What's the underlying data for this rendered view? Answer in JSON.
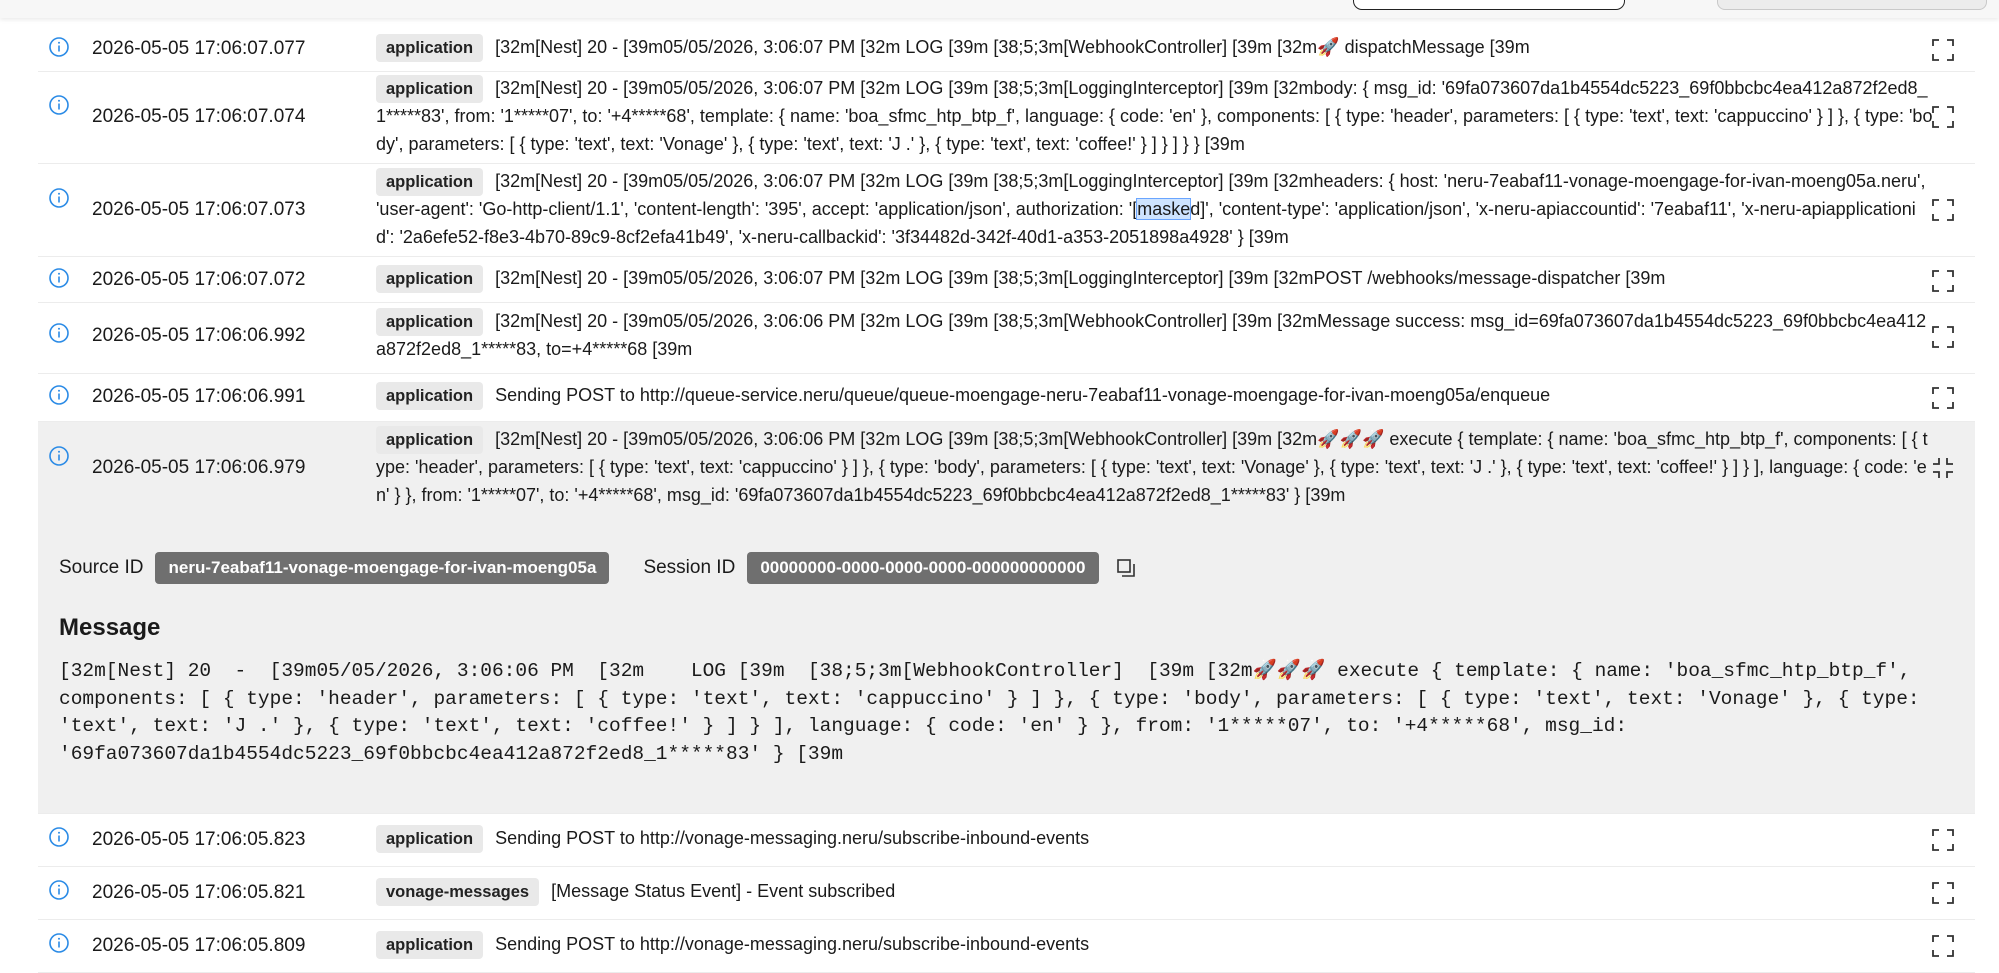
{
  "colors": {
    "accent": "#2b8be6",
    "badge_bg": "#e9e9e9",
    "chip_bg": "#6f6f6f",
    "selected_bg": "#f0f0f0"
  },
  "logs": [
    {
      "timestamp": "2026-05-05 17:06:07.077",
      "badge": "application",
      "text": "[32m[Nest] 20 -  [39m05/05/2026, 3:06:07 PM  [32m LOG [39m  [38;5;3m[WebhookController]  [39m [32m🚀 dispatchMessage [39m"
    },
    {
      "timestamp": "2026-05-05 17:06:07.074",
      "badge": "application",
      "text": "[32m[Nest] 20 -  [39m05/05/2026, 3:06:07 PM  [32m LOG [39m  [38;5;3m[LoggingInterceptor]  [39m [32mbody: { msg_id: '69fa073607da1b4554dc5223_69f0bbcbc4ea412a872f2ed8_1*****83', from: '1*****07', to: '+4*****68', template: { name: 'boa_sfmc_htp_btp_f', language: { code: 'en' }, components: [ { type: 'header', parameters: [ { type: 'text', text: 'cappuccino' } ] }, { type: 'body', parameters: [ { type: 'text', text: 'Vonage' }, { type: 'text', text: 'J .' }, { type: 'text', text: 'coffee!' } ] } ] } } [39m"
    },
    {
      "timestamp": "2026-05-05 17:06:07.073",
      "badge": "application",
      "text_before": "[32m[Nest] 20 -  [39m05/05/2026, 3:06:07 PM  [32m LOG [39m  [38;5;3m[LoggingInterceptor]  [39m [32mheaders: { host: 'neru-7eabaf11-vonage-moengage-for-ivan-moeng05a.neru', 'user-agent': 'Go-http-client/1.1', 'content-length': '395', accept: 'application/json', authorization: '[",
      "text_highlight": "maske",
      "text_after": "d]', 'content-type': 'application/json', 'x-neru-apiaccountid': '7eabaf11', 'x-neru-apiapplicationid': '2a6efe52-f8e3-4b70-89c9-8cf2efa41b49', 'x-neru-callbackid': '3f34482d-342f-40d1-a353-2051898a4928' } [39m"
    },
    {
      "timestamp": "2026-05-05 17:06:07.072",
      "badge": "application",
      "text": "[32m[Nest] 20 -  [39m05/05/2026, 3:06:07 PM  [32m LOG [39m  [38;5;3m[LoggingInterceptor]  [39m [32mPOST /webhooks/message-dispatcher [39m"
    },
    {
      "timestamp": "2026-05-05 17:06:06.992",
      "badge": "application",
      "text": "[32m[Nest] 20 -  [39m05/05/2026, 3:06:06 PM  [32m LOG [39m  [38;5;3m[WebhookController]  [39m [32mMessage success: msg_id=69fa073607da1b4554dc5223_69f0bbcbc4ea412a872f2ed8_1*****83, to=+4*****68 [39m"
    },
    {
      "timestamp": "2026-05-05 17:06:06.991",
      "badge": "application",
      "text": "Sending POST to http://queue-service.neru/queue/queue-moengage-neru-7eabaf11-vonage-moengage-for-ivan-moeng05a/enqueue"
    },
    {
      "timestamp": "2026-05-05 17:06:06.979",
      "badge": "application",
      "text": "[32m[Nest] 20 -  [39m05/05/2026, 3:06:06 PM  [32m LOG [39m  [38;5;3m[WebhookController]  [39m [32m🚀🚀🚀 execute { template: { name: 'boa_sfmc_htp_btp_f', components: [ { type: 'header', parameters: [ { type: 'text', text: 'cappuccino' } ] }, { type: 'body', parameters: [ { type: 'text', text: 'Vonage' }, { type: 'text', text: 'J .' }, { type: 'text', text: 'coffee!' } ] } ], language: { code: 'en' } }, from: '1*****07', to: '+4*****68', msg_id: '69fa073607da1b4554dc5223_69f0bbcbc4ea412a872f2ed8_1*****83' } [39m"
    },
    {
      "timestamp": "2026-05-05 17:06:05.823",
      "badge": "application",
      "text": "Sending POST to http://vonage-messaging.neru/subscribe-inbound-events"
    },
    {
      "timestamp": "2026-05-05 17:06:05.821",
      "badge": "vonage-messages",
      "text": "[Message Status Event] - Event subscribed"
    },
    {
      "timestamp": "2026-05-05 17:06:05.809",
      "badge": "application",
      "text": "Sending POST to http://vonage-messaging.neru/subscribe-inbound-events"
    }
  ],
  "detail": {
    "source_id_label": "Source ID",
    "source_id": "neru-7eabaf11-vonage-moengage-for-ivan-moeng05a",
    "session_id_label": "Session ID",
    "session_id": "00000000-0000-0000-0000-000000000000",
    "message_heading": "Message",
    "message": "[32m[Nest] 20  -  [39m05/05/2026, 3:06:06 PM  [32m    LOG [39m  [38;5;3m[WebhookController]  [39m [32m🚀🚀🚀 execute { template: { name: 'boa_sfmc_htp_btp_f', components: [ { type: 'header', parameters: [ { type: 'text', text: 'cappuccino' } ] }, { type: 'body', parameters: [ { type: 'text', text: 'Vonage' }, { type: 'text', text: 'J .' }, { type: 'text', text: 'coffee!' } ] } ], language: { code: 'en' } }, from: '1*****07', to: '+4*****68', msg_id: '69fa073607da1b4554dc5223_69f0bbcbc4ea412a872f2ed8_1*****83' } [39m"
  }
}
